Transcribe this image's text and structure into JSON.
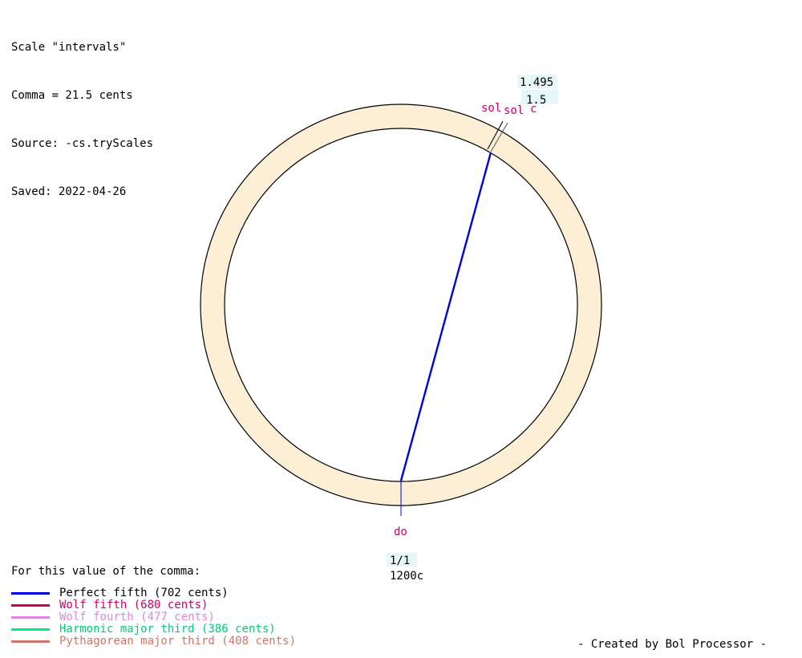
{
  "header": {
    "scale_line": "Scale \"intervals\"",
    "comma_line": "Comma = 21.5 cents",
    "source_line": "Source: -cs.tryScales",
    "saved_line": "Saved: 2022-04-26"
  },
  "notes": {
    "do": {
      "name": "do",
      "ratio": "1/1",
      "cents": "1200c"
    },
    "sol_1": {
      "name": "sol",
      "ratio": "1.495",
      "cents": ""
    },
    "sol_2": {
      "name": "sol",
      "ratio": "1.5",
      "cents": "c"
    }
  },
  "interval_lines": [
    {
      "from": "do",
      "to": "sol",
      "type": "Perfect fifth",
      "color": "#0000dd"
    }
  ],
  "legend": {
    "title": "For this value of the comma:",
    "items": [
      {
        "label": "Perfect fifth (702 cents)",
        "color": "#0000dd"
      },
      {
        "label": "Wolf fifth (680 cents)",
        "color": "#cc0066"
      },
      {
        "label": "Wolf fourth (477 cents)",
        "color": "#dd88dd"
      },
      {
        "label": "Harmonic major third (386 cents)",
        "color": "#00ee88"
      },
      {
        "label": "Pythagorean major third (408 cents)",
        "color": "#cc7766"
      }
    ]
  },
  "credit": "- Created by Bol Processor -",
  "colors": {
    "ring_fill": "#fdeed6",
    "note_name": "#cc0066",
    "label_bg": "#e6f7f7"
  }
}
